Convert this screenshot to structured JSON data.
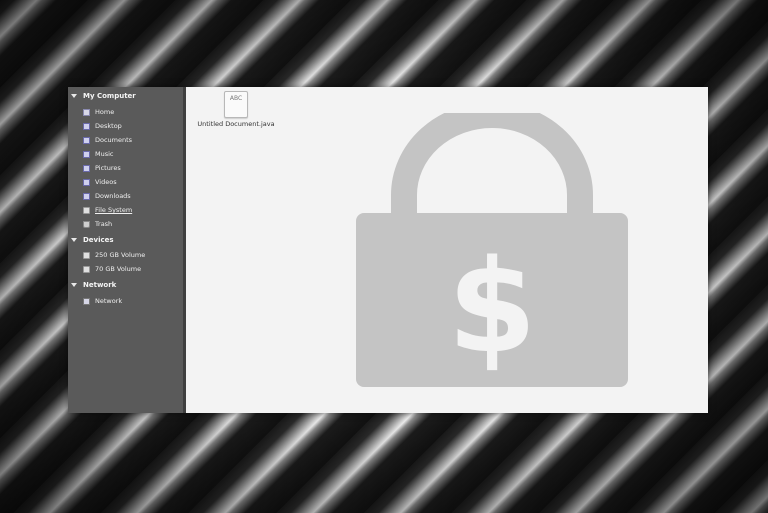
{
  "sidebar": {
    "sections": [
      {
        "label": "My Computer",
        "items": [
          {
            "label": "Home",
            "icon": "home-icon"
          },
          {
            "label": "Desktop",
            "icon": "folder-icon"
          },
          {
            "label": "Documents",
            "icon": "folder-icon"
          },
          {
            "label": "Music",
            "icon": "folder-icon"
          },
          {
            "label": "Pictures",
            "icon": "folder-icon"
          },
          {
            "label": "Videos",
            "icon": "folder-icon"
          },
          {
            "label": "Downloads",
            "icon": "folder-icon"
          },
          {
            "label": "File System",
            "icon": "drive-icon"
          },
          {
            "label": "Trash",
            "icon": "trash-icon"
          }
        ]
      },
      {
        "label": "Devices",
        "items": [
          {
            "label": "250 GB Volume",
            "icon": "drive-icon"
          },
          {
            "label": "70 GB Volume",
            "icon": "drive-icon"
          }
        ]
      },
      {
        "label": "Network",
        "items": [
          {
            "label": "Network",
            "icon": "network-icon"
          }
        ]
      }
    ]
  },
  "main": {
    "file": {
      "icon_text": "ABC",
      "name": "Untitled Document.java"
    },
    "overlay": {
      "icon": "locked-dollar-padlock-icon",
      "symbol": "$",
      "color": "#c4c4c4"
    }
  },
  "colors": {
    "sidebar_bg": "#5a5a5a",
    "content_bg": "#f3f3f3"
  }
}
